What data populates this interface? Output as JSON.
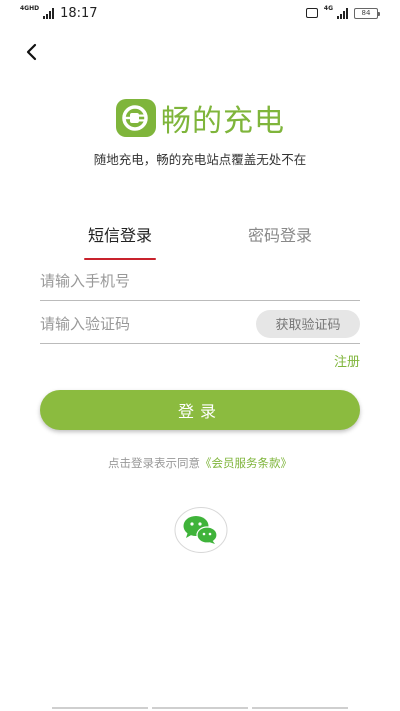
{
  "status_bar": {
    "network_label": "4GHD",
    "time": "18:17",
    "signal_label": "4G",
    "battery": "84"
  },
  "brand": {
    "name": "畅的充电",
    "slogan": "随地充电，畅的充电站点覆盖无处不在",
    "color": "#7fb53b"
  },
  "tabs": [
    {
      "label": "短信登录",
      "active": true
    },
    {
      "label": "密码登录",
      "active": false
    }
  ],
  "form": {
    "phone_placeholder": "请输入手机号",
    "code_placeholder": "请输入验证码",
    "get_code_label": "获取验证码",
    "register_label": "注册",
    "login_label": "登录"
  },
  "agreement": {
    "prefix": "点击登录表示同意",
    "link": "《会员服务条款》"
  },
  "social": {
    "wechat_icon": "wechat-icon"
  },
  "colors": {
    "accent_green": "#8bbb3f",
    "tab_indicator_red": "#c8222c"
  }
}
